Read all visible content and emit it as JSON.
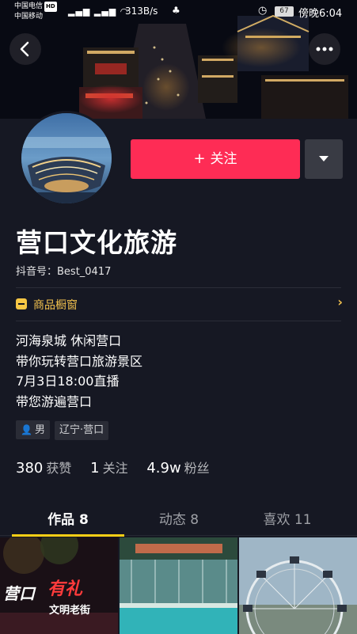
{
  "status_bar": {
    "carrier_1": "中国电信",
    "hd_badge": "HD",
    "carrier_2": "中国移动",
    "net_speed": "313B/s",
    "battery": "67",
    "time": "傍晚6:04"
  },
  "header": {
    "back_icon": "back-arrow-icon",
    "more_icon": "more-dots-icon"
  },
  "profile": {
    "follow_label": "关注",
    "follow_plus": "+",
    "name": "营口文化旅游",
    "douyin_id": "抖音号：Best_0417",
    "shop_label": "商品橱窗",
    "shop_arrow": "›",
    "bio_lines": [
      "河海泉城 休闲营口",
      "带你玩转营口旅游景区",
      "7月3日18:00直播",
      "带您游遍营口"
    ],
    "gender": "男",
    "location": "辽宁·营口"
  },
  "stats": {
    "likes_num": "380",
    "likes_label": "获赞",
    "following_num": "1",
    "following_label": "关注",
    "fans_num": "4.9w",
    "fans_label": "粉丝"
  },
  "tabs": {
    "works": "作品 8",
    "dynamic": "动态 8",
    "likes": "喜欢 11"
  },
  "thumbnails": {
    "thumb1_text_1": "营口",
    "thumb1_text_2": "有礼",
    "thumb1_text_3": "文明老街"
  },
  "colors": {
    "background": "#161823",
    "follow_button": "#fe2c55",
    "tab_indicator": "#face15",
    "shop_accent": "#f2c14e"
  }
}
